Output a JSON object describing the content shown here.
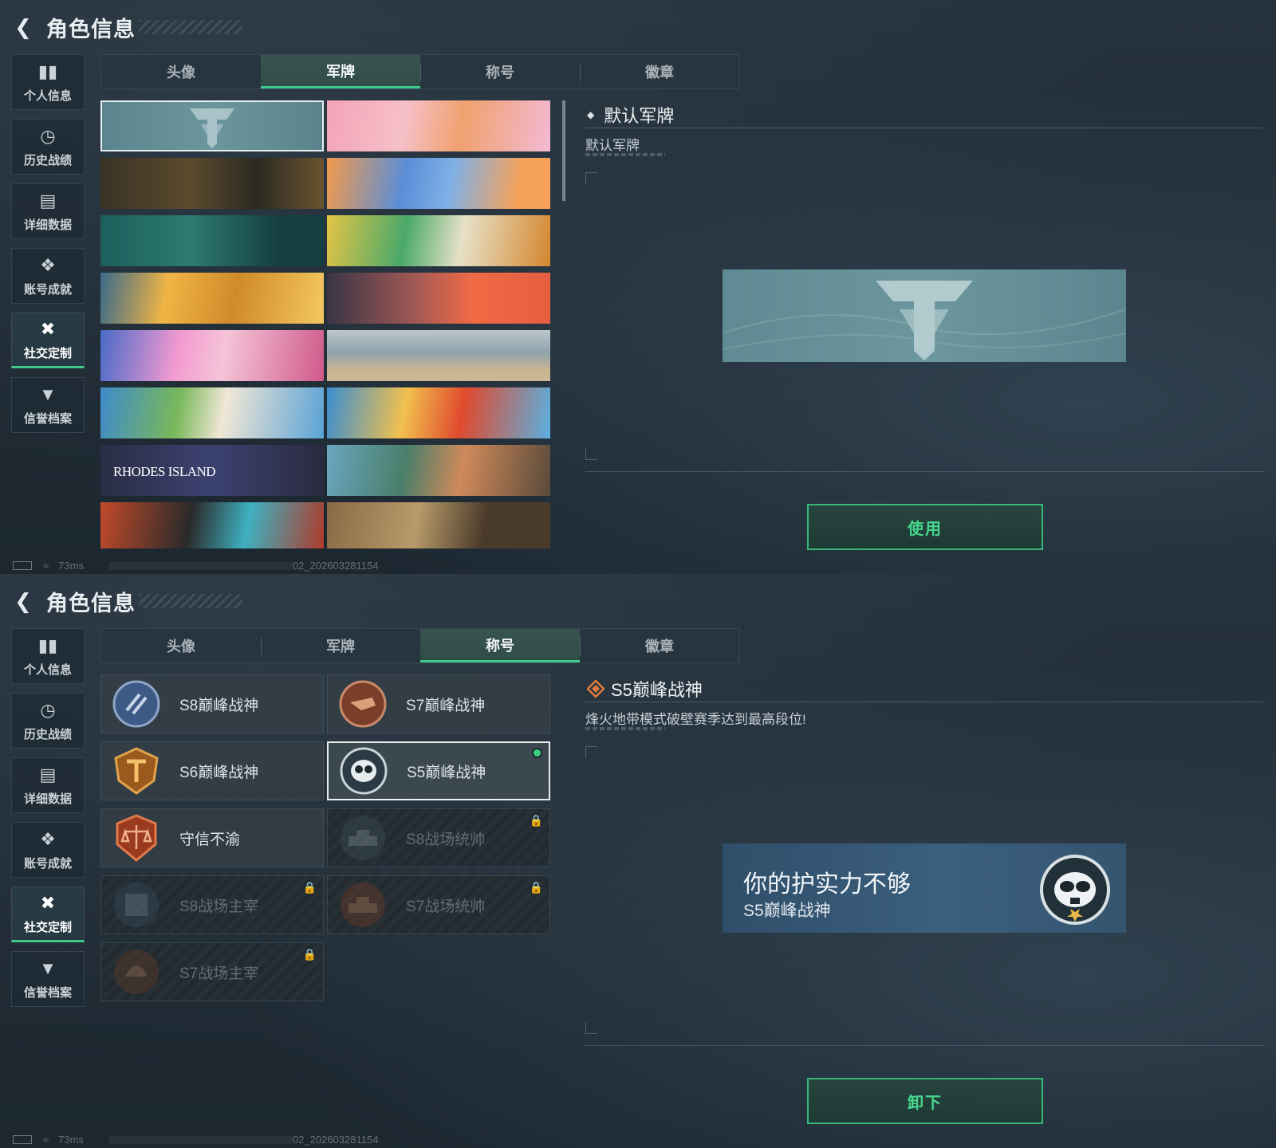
{
  "header": {
    "title": "角色信息"
  },
  "sidebar": {
    "items": [
      {
        "label": "个人信息",
        "icon": "bar-chart-icon"
      },
      {
        "label": "历史战绩",
        "icon": "history-clock-icon"
      },
      {
        "label": "详细数据",
        "icon": "folder-icon"
      },
      {
        "label": "账号成就",
        "icon": "achievement-icon"
      },
      {
        "label": "社交定制",
        "icon": "tools-icon"
      },
      {
        "label": "信誉档案",
        "icon": "shield-icon"
      }
    ],
    "active_index": 4
  },
  "tabs": [
    "头像",
    "军牌",
    "称号",
    "徽章"
  ],
  "screen1": {
    "active_tab": "军牌",
    "banner_text": "RHODES ISLAND",
    "detail": {
      "title": "默认军牌",
      "desc": "默认军牌"
    },
    "action_label": "使用"
  },
  "screen2": {
    "active_tab": "称号",
    "titles": [
      {
        "name": "S8巅峰战神",
        "locked": false
      },
      {
        "name": "S7巅峰战神",
        "locked": false
      },
      {
        "name": "S6巅峰战神",
        "locked": false
      },
      {
        "name": "S5巅峰战神",
        "locked": false,
        "selected": true,
        "equipped": true
      },
      {
        "name": "守信不渝",
        "locked": false
      },
      {
        "name": "S8战场统帅",
        "locked": true
      },
      {
        "name": "S8战场主宰",
        "locked": true
      },
      {
        "name": "S7战场统帅",
        "locked": true
      },
      {
        "name": "S7战场主宰",
        "locked": true
      }
    ],
    "detail": {
      "title": "S5巅峰战神",
      "desc": "烽火地带模式破壁赛季达到最高段位!"
    },
    "preview": {
      "headline": "你的护实力不够",
      "title": "S5巅峰战神"
    },
    "action_label": "卸下"
  },
  "status": {
    "ping": "73ms",
    "version": "02_202603281154"
  },
  "colors": {
    "accent_green": "#3fc98a",
    "button_text": "#46d98f",
    "bg": "#1f2a33"
  }
}
